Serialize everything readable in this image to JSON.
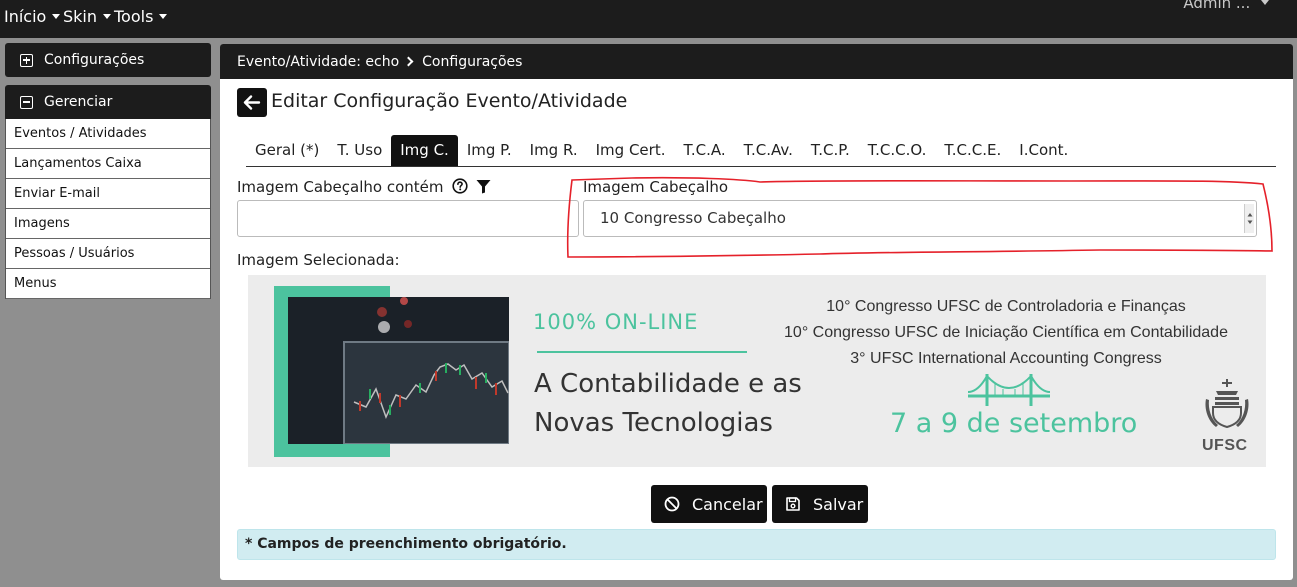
{
  "topnav": {
    "items": [
      {
        "label": "Início"
      },
      {
        "label": "Skin"
      },
      {
        "label": "Tools"
      }
    ],
    "user": "Admin ... "
  },
  "sidebar": {
    "config_panel": {
      "label": "Configurações"
    },
    "manage_panel": {
      "label": "Gerenciar",
      "items": [
        {
          "label": "Eventos / Atividades"
        },
        {
          "label": "Lançamentos Caixa"
        },
        {
          "label": "Enviar E-mail"
        },
        {
          "label": "Imagens"
        },
        {
          "label": "Pessoas / Usuários"
        },
        {
          "label": "Menus"
        }
      ]
    }
  },
  "breadcrumb": {
    "parent": "Evento/Atividade: echo",
    "current": "Configurações"
  },
  "page": {
    "title": "Editar Configuração Evento/Atividade"
  },
  "tabs": [
    {
      "label": "Geral (*)",
      "active": false
    },
    {
      "label": "T. Uso",
      "active": false
    },
    {
      "label": "Img C.",
      "active": true
    },
    {
      "label": "Img P.",
      "active": false
    },
    {
      "label": "Img R.",
      "active": false
    },
    {
      "label": "Img Cert.",
      "active": false
    },
    {
      "label": "T.C.A.",
      "active": false
    },
    {
      "label": "T.C.Av.",
      "active": false
    },
    {
      "label": "T.C.P.",
      "active": false
    },
    {
      "label": "T.C.C.O.",
      "active": false
    },
    {
      "label": "T.C.C.E.",
      "active": false
    },
    {
      "label": "I.Cont.",
      "active": false
    }
  ],
  "form": {
    "filter_label": "Imagem Cabeçalho contém",
    "filter_value": "",
    "select_label": "Imagem Cabeçalho",
    "select_value": "10 Congresso Cabeçalho",
    "selected_image_label": "Imagem Selecionada:"
  },
  "banner": {
    "tagline": "100% ON-LINE",
    "headline_line1": "A Contabilidade e as",
    "headline_line2": "Novas Tecnologias",
    "event_lines": [
      "10° Congresso UFSC de Controladoria e Finanças",
      "10° Congresso UFSC de Iniciação Científica em Contabilidade",
      "3° UFSC International Accounting Congress"
    ],
    "date": "7 a 9 de setembro",
    "logo_text": "UFSC"
  },
  "actions": {
    "cancel_label": "Cancelar",
    "save_label": "Salvar"
  },
  "notice": "* Campos de preenchimento obrigatório.",
  "colors": {
    "accent_green": "#4cc39e",
    "dark": "#1c1c1c",
    "alert_bg": "#d1ecf1",
    "highlight_red": "#e5212a"
  }
}
